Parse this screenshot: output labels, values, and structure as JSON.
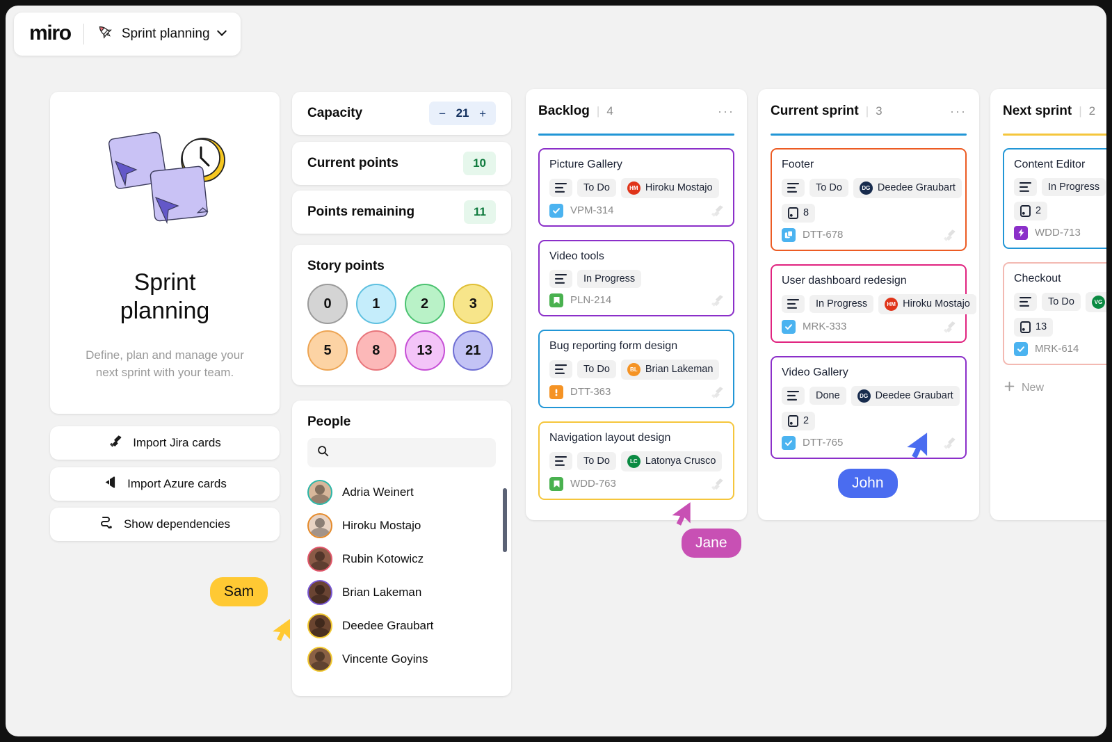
{
  "header": {
    "logo": "miro",
    "rocket_icon": "rocket-icon",
    "board_name": "Sprint planning",
    "chevron_icon": "chevron-down-icon"
  },
  "hero": {
    "title": "Sprint\nplanning",
    "title_line1": "Sprint",
    "title_line2": "planning",
    "subtitle": "Define, plan and manage your next sprint with your team."
  },
  "actions": [
    {
      "label": "Import Jira cards",
      "icon": "jira-icon"
    },
    {
      "label": "Import Azure cards",
      "icon": "azure-devops-icon"
    },
    {
      "label": "Show dependencies",
      "icon": "dependencies-icon"
    }
  ],
  "capacity": {
    "label": "Capacity",
    "minus": "−",
    "value": "21",
    "plus": "+"
  },
  "current_points": {
    "label": "Current points",
    "value": "10"
  },
  "points_remaining": {
    "label": "Points remaining",
    "value": "11"
  },
  "story_points": {
    "title": "Story points",
    "chips": [
      {
        "value": "0",
        "fill": "#d4d4d4",
        "stroke": "#9b9b9b"
      },
      {
        "value": "1",
        "fill": "#c5edfb",
        "stroke": "#5ec0e0"
      },
      {
        "value": "2",
        "fill": "#b9f2c7",
        "stroke": "#4cc271"
      },
      {
        "value": "3",
        "fill": "#f7e58a",
        "stroke": "#e0bf36"
      },
      {
        "value": "5",
        "fill": "#fcd3a4",
        "stroke": "#eda554"
      },
      {
        "value": "8",
        "fill": "#fcb8b8",
        "stroke": "#e8757b"
      },
      {
        "value": "13",
        "fill": "#f3c4f8",
        "stroke": "#d martin"
      },
      {
        "value": "21",
        "fill": "#c3c3f5",
        "stroke": "#6f6fd4"
      }
    ]
  },
  "people": {
    "title": "People",
    "search_placeholder": "",
    "search_value": "",
    "search_icon": "search-icon",
    "members": [
      {
        "name": "Adria Weinert",
        "ring": "#2bb6a8",
        "skin": "#d8b79b"
      },
      {
        "name": "Hiroku Mostajo",
        "ring": "#e58a2a",
        "skin": "#e8d3c4"
      },
      {
        "name": "Rubin Kotowicz",
        "ring": "#e0566a",
        "skin": "#8a5a46"
      },
      {
        "name": "Brian Lakeman",
        "ring": "#7857d4",
        "skin": "#6a4433"
      },
      {
        "name": "Deedee Graubart",
        "ring": "#f2c930",
        "skin": "#6b4530"
      },
      {
        "name": "Vincente Goyins",
        "ring": "#f2c930",
        "skin": "#8a6145"
      }
    ]
  },
  "board": {
    "columns": [
      {
        "title": "Backlog",
        "separator": "|",
        "count": "4",
        "menu": "···",
        "rule_color": "#2196d6",
        "cards": [
          {
            "title": "Picture Gallery",
            "border": "#8b2fc9",
            "type_icon": "description-icon",
            "status": "To Do",
            "assignee": "Hiroku Mostajo",
            "assignee_initials": "HM",
            "assignee_color": "#e03419",
            "points": null,
            "ticket_id": "VPM-314",
            "ticket_icon": "task-check-icon",
            "ticket_icon_color": "#4bb3f0"
          },
          {
            "title": "Video tools",
            "border": "#8b2fc9",
            "type_icon": "description-icon",
            "status": "In Progress",
            "assignee": null,
            "assignee_initials": null,
            "assignee_color": null,
            "points": null,
            "ticket_id": "PLN-214",
            "ticket_icon": "story-bookmark-icon",
            "ticket_icon_color": "#49b14f"
          },
          {
            "title": "Bug reporting form design",
            "border": "#2196d6",
            "type_icon": "description-icon",
            "status": "To Do",
            "assignee": "Brian Lakeman",
            "assignee_initials": "BL",
            "assignee_color": "#f59324",
            "points": null,
            "ticket_id": "DTT-363",
            "ticket_icon": "bug-alert-icon",
            "ticket_icon_color": "#f59324"
          },
          {
            "title": "Navigation layout design",
            "border": "#f5c63c",
            "type_icon": "description-icon",
            "status": "To Do",
            "assignee": "Latonya Crusco",
            "assignee_initials": "LC",
            "assignee_color": "#0a8a42",
            "points": null,
            "ticket_id": "WDD-763",
            "ticket_icon": "story-bookmark-icon",
            "ticket_icon_color": "#49b14f"
          }
        ]
      },
      {
        "title": "Current sprint",
        "separator": "|",
        "count": "3",
        "menu": "···",
        "rule_color": "#2196d6",
        "cards": [
          {
            "title": "Footer",
            "border": "#ec5b23",
            "type_icon": "description-icon",
            "status": "To Do",
            "assignee": "Deedee Graubart",
            "assignee_initials": "DG",
            "assignee_color": "#172b4d",
            "points": "8",
            "ticket_id": "DTT-678",
            "ticket_icon": "epic-copy-icon",
            "ticket_icon_color": "#4bb3f0"
          },
          {
            "title": "User dashboard redesign",
            "border": "#e0237f",
            "type_icon": "description-icon",
            "status": "In Progress",
            "assignee": "Hiroku Mostajo",
            "assignee_initials": "HM",
            "assignee_color": "#e03419",
            "points": null,
            "ticket_id": "MRK-333",
            "ticket_icon": "task-check-icon",
            "ticket_icon_color": "#4bb3f0"
          },
          {
            "title": "Video Gallery",
            "border": "#8b2fc9",
            "type_icon": "description-icon",
            "status": "Done",
            "assignee": "Deedee Graubart",
            "assignee_initials": "DG",
            "assignee_color": "#172b4d",
            "points": "2",
            "ticket_id": "DTT-765",
            "ticket_icon": "task-check-icon",
            "ticket_icon_color": "#4bb3f0"
          }
        ]
      },
      {
        "title": "Next sprint",
        "separator": "|",
        "count": "2",
        "menu": "···",
        "rule_color": "#f5c63c",
        "new_label": "New",
        "new_icon": "plus-icon",
        "cards": [
          {
            "title": "Content Editor",
            "border": "#2196d6",
            "type_icon": "description-icon",
            "status": "In Progress",
            "assignee": null,
            "assignee_initials": null,
            "assignee_color": null,
            "points": "2",
            "ticket_id": "WDD-713",
            "ticket_icon": "bolt-icon",
            "ticket_icon_color": "#8b2fc9"
          },
          {
            "title": "Checkout",
            "border": "#f3b9b2",
            "type_icon": "description-icon",
            "status": "To Do",
            "assignee": "V",
            "assignee_initials": "VG",
            "assignee_color": "#0a8a42",
            "points": "13",
            "ticket_id": "MRK-614",
            "ticket_icon": "task-check-icon",
            "ticket_icon_color": "#4bb3f0"
          }
        ]
      }
    ]
  },
  "cursors": [
    {
      "name": "Sam",
      "color": "#ffc933",
      "text_color": "#111111"
    },
    {
      "name": "Jane",
      "color": "#c850b4",
      "text_color": "#ffffff"
    },
    {
      "name": "John",
      "color": "#4a6cf0",
      "text_color": "#ffffff"
    }
  ]
}
